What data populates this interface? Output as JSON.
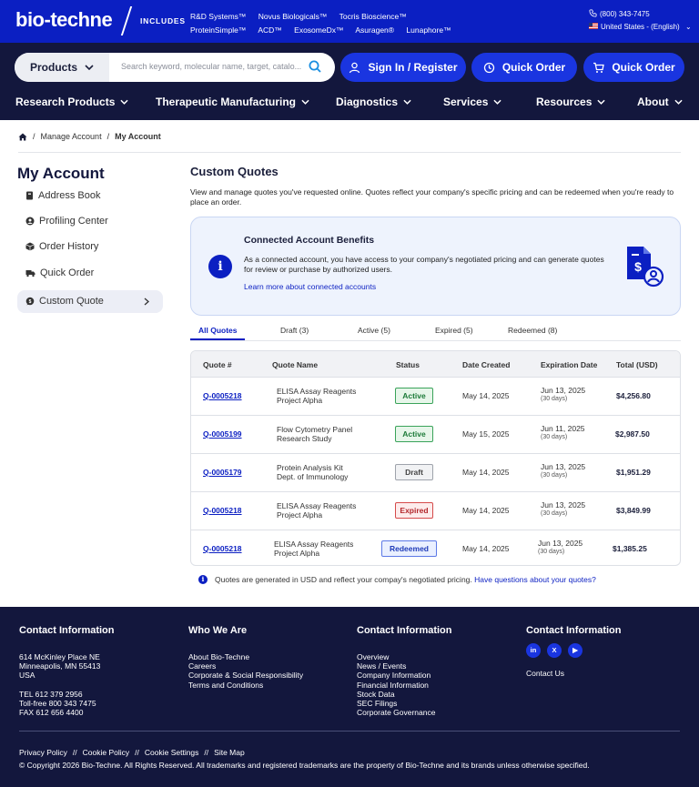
{
  "topbar": {
    "logo": "bio-techne",
    "includes_label": "INCLUDES",
    "brands_row1": [
      "R&D Systems™",
      "Novus Biologicals™",
      "Tocris Bioscience™"
    ],
    "brands_row2": [
      "ProteinSimple™",
      "ACD™",
      "ExosomeDx™",
      "Asuragen®",
      "Lunaphore™"
    ],
    "phone": "(800) 343-7475",
    "region": "United States - (English)"
  },
  "header": {
    "products_label": "Products",
    "search_placeholder": "Search keyword, molecular name, target, catalo...",
    "sign_in_label": "Sign In / Register",
    "quick_order_label_1": "Quick Order",
    "quick_order_label_2": "Quick Order",
    "nav": [
      "Research Products",
      "Therapeutic Manufacturing",
      "Diagnostics",
      "Services",
      "Resources",
      "About"
    ]
  },
  "breadcrumb": {
    "home_icon": "home-icon",
    "items": [
      "Manage Account",
      "My Account"
    ],
    "separator": "/"
  },
  "sidebar": {
    "title": "My Account",
    "items": [
      {
        "label": "Address Book",
        "icon": "address-book-icon"
      },
      {
        "label": "Profiling Center",
        "icon": "user-icon"
      },
      {
        "label": "Order History",
        "icon": "box-icon"
      },
      {
        "label": "Quick Order",
        "icon": "truck-icon"
      },
      {
        "label": "Custom Quote",
        "icon": "chat-icon",
        "active": true
      }
    ]
  },
  "main": {
    "title": "Custom Quotes",
    "intro": "View and manage quotes you've requested online. Quotes reflect your company's specific pricing and can be redeemed when you're ready to place an order.",
    "benefit": {
      "title": "Connected Account Benefits",
      "body": "As a connected account, you have access to your company's negotiated pricing and can generate quotes for review or purchase by authorized users.",
      "link": "Learn more about connected accounts"
    },
    "tabs": [
      "All Quotes",
      "Draft (3)",
      "Active (5)",
      "Expired (5)",
      "Redeemed (8)"
    ],
    "columns": [
      "Quote #",
      "Quote Name",
      "Status",
      "Date Created",
      "Expiration Date",
      "Total (USD)"
    ],
    "rows": [
      {
        "id": "Q-0005218",
        "name1": "ELISA Assay Reagents",
        "name2": "Project Alpha",
        "status": "Active",
        "created": "May 14, 2025",
        "expires": "Jun 13, 2025",
        "days": "(30 days)",
        "total": "$4,256.80"
      },
      {
        "id": "Q-0005199",
        "name1": "Flow Cytometry Panel",
        "name2": "Research Study",
        "status": "Active",
        "created": "May 15, 2025",
        "expires": "Jun 11, 2025",
        "days": "(30 days)",
        "total": "$2,987.50"
      },
      {
        "id": "Q-0005179",
        "name1": "Protein Analysis Kit",
        "name2": "Dept. of Immunology",
        "status": "Draft",
        "created": "May 14, 2025",
        "expires": "Jun 13, 2025",
        "days": "(30 days)",
        "total": "$1,951.29"
      },
      {
        "id": "Q-0005218",
        "name1": "ELISA Assay Reagents",
        "name2": "Project Alpha",
        "status": "Expired",
        "created": "May 14, 2025",
        "expires": "Jun 13, 2025",
        "days": "(30 days)",
        "total": "$3,849.99"
      },
      {
        "id": "Q-0005218",
        "name1": "ELISA Assay Reagents",
        "name2": "Project Alpha",
        "status": "Redeemed",
        "created": "May 14, 2025",
        "expires": "Jun 13, 2025",
        "days": "(30 days)",
        "total": "$1,385.25"
      }
    ],
    "note": "Quotes are generated in USD and reflect your compay's negotiated pricing.",
    "note_link": "Have questions about your quotes?"
  },
  "footer": {
    "col1": {
      "head": "Contact Information",
      "addr": [
        "614 McKinley Place NE",
        "Minneapolis, MN 55413",
        "USA"
      ],
      "phones": [
        "TEL 612 379 2956",
        "Toll-free 800 343 7475",
        "FAX 612 656 4400"
      ]
    },
    "col2": {
      "head": "Who We Are",
      "links": [
        "About Bio-Techne",
        "Careers",
        "Corporate & Social Responsibility",
        "Terms and Conditions"
      ]
    },
    "col3": {
      "head": "Contact Information",
      "links": [
        "Overview",
        "News / Events",
        "Company Information",
        "Financial Information",
        "Stock Data",
        "SEC Filings",
        "Corporate Governance"
      ]
    },
    "col4": {
      "head": "Contact Information",
      "social": [
        "in",
        "X",
        "▶"
      ],
      "contact_us": "Contact Us"
    },
    "bottom_links": [
      "Privacy Policy",
      "Cookie Policy",
      "Cookie Settings",
      "Site Map"
    ],
    "bottom_sep": "//",
    "copyright": "© Copyright 2026 Bio-Techne. All Rights Reserved. All trademarks and registered trademarks are the property of Bio-Techne and its brands unless otherwise specified."
  },
  "colors": {
    "brand_blue": "#0b1fc2",
    "navy": "#13173d",
    "button_blue": "#1a35e0"
  }
}
